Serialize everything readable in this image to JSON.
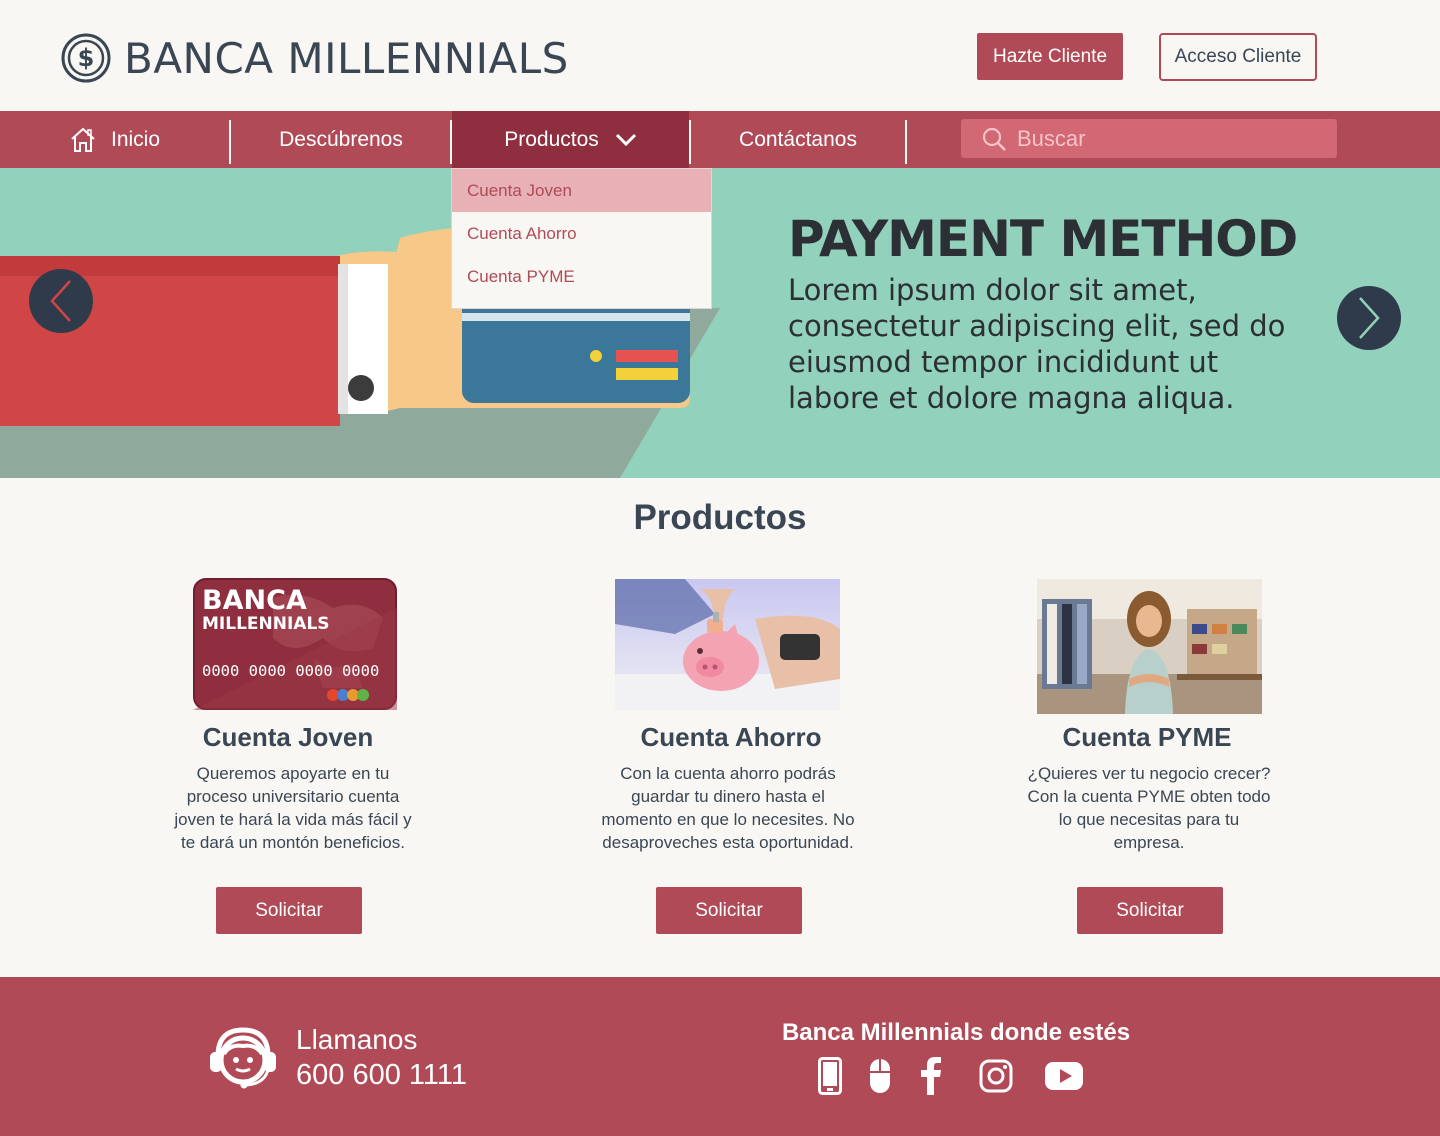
{
  "brand": {
    "name": "BANCA MILLENNIALS",
    "accent": "#b14a57",
    "accent_dark": "#8e2e3e",
    "text": "#3a4654"
  },
  "header": {
    "signup_label": "Hazte Cliente",
    "login_label": "Acceso Cliente"
  },
  "nav": {
    "items": [
      {
        "label": "Inicio",
        "icon": "home-icon"
      },
      {
        "label": "Descúbrenos"
      },
      {
        "label": "Productos",
        "icon": "chevron-down-icon",
        "active": true
      },
      {
        "label": "Contáctanos"
      }
    ],
    "search_placeholder": "Buscar"
  },
  "dropdown": {
    "items": [
      "Cuenta Joven",
      "Cuenta Ahorro",
      "Cuenta PYME"
    ],
    "highlighted": "Cuenta Joven"
  },
  "hero": {
    "title": "PAYMENT METHOD",
    "text": "Lorem ipsum dolor sit amet, consectetur adipiscing elit, sed do eiusmod tempor incididunt ut labore et dolore magna aliqua."
  },
  "products": {
    "title": "Productos",
    "card_brand_line1": "BANCA",
    "card_brand_line2": "MILLENNIALS",
    "card_number": "0000 0000 0000 0000",
    "items": [
      {
        "title": "Cuenta Joven",
        "description": "Queremos apoyarte en tu proceso universitario cuenta joven te hará la vida más fácil y te dará un montón beneficios.",
        "button": "Solicitar"
      },
      {
        "title": "Cuenta Ahorro",
        "description": "Con la cuenta ahorro podrás guardar tu dinero hasta el momento en que lo necesites. No desaproveches esta oportunidad.",
        "button": "Solicitar"
      },
      {
        "title": "Cuenta PYME",
        "description": "¿Quieres ver tu negocio crecer?\nCon la cuenta PYME obten todo lo que necesitas para tu empresa.",
        "button": "Solicitar"
      }
    ]
  },
  "footer": {
    "call_label": "Llamanos",
    "phone": "600 600 1111",
    "social_title": "Banca Millennials donde estés",
    "icons": [
      "mobile-icon",
      "mouse-icon",
      "facebook-icon",
      "instagram-icon",
      "youtube-icon"
    ]
  }
}
